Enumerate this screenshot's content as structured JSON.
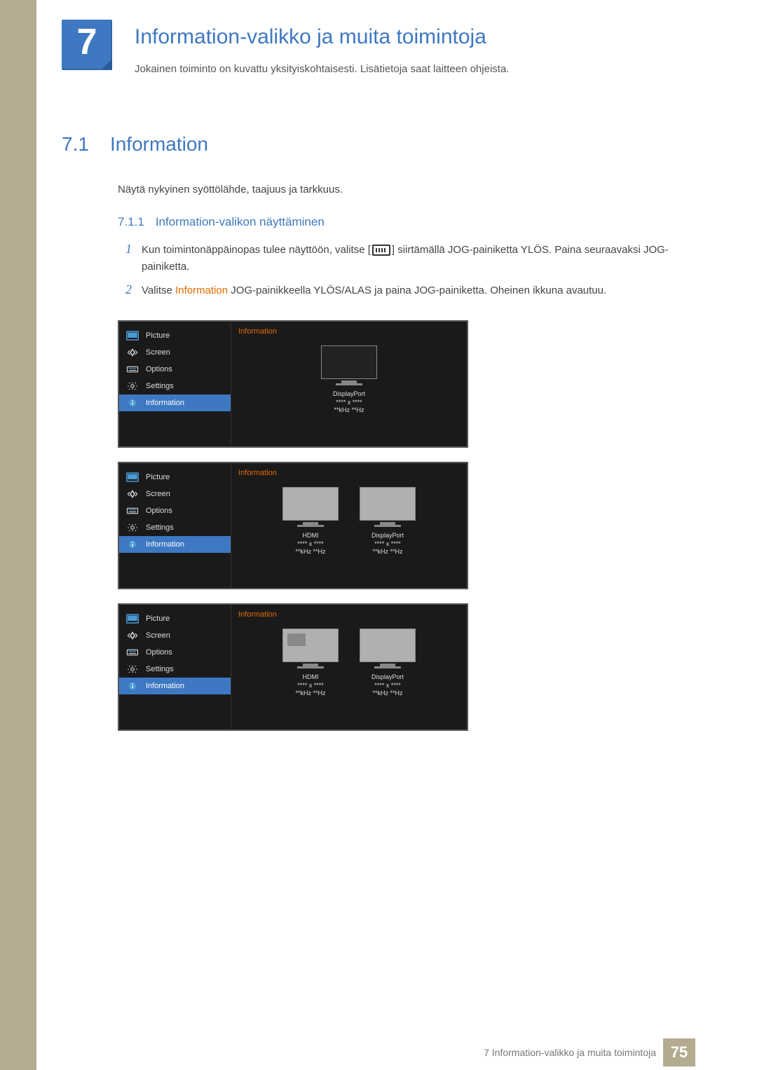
{
  "chapter": {
    "number": "7",
    "title": "Information-valikko ja muita toimintoja",
    "subtitle": "Jokainen toiminto on kuvattu yksityiskohtaisesti. Lisätietoja saat laitteen ohjeista."
  },
  "section": {
    "number": "7.1",
    "title": "Information",
    "desc": "Näytä nykyinen syöttölähde, taajuus ja tarkkuus."
  },
  "subsection": {
    "number": "7.1.1",
    "title": "Information-valikon näyttäminen"
  },
  "steps": {
    "s1_pre": "Kun toimintonäppäinopas tulee näyttöön, valitse [",
    "s1_post": "] siirtämällä JOG-painiketta YLÖS. Paina seuraavaksi JOG-painiketta.",
    "s2_a": "Valitse ",
    "s2_bold": "Information",
    "s2_b": " JOG-painikkeella YLÖS/ALAS ja paina JOG-painiketta. Oheinen ikkuna avautuu."
  },
  "osd": {
    "menu": [
      {
        "label": "Picture",
        "icon": "picture-icon"
      },
      {
        "label": "Screen",
        "icon": "screen-icon"
      },
      {
        "label": "Options",
        "icon": "options-icon"
      },
      {
        "label": "Settings",
        "icon": "settings-icon"
      },
      {
        "label": "Information",
        "icon": "info-icon"
      }
    ],
    "panel_title": "Information",
    "panels": [
      {
        "monitors": [
          {
            "port": "DisplayPort",
            "res": "**** x ****",
            "freq": "**kHz **Hz",
            "style": "dark"
          }
        ]
      },
      {
        "monitors": [
          {
            "port": "HDMI",
            "res": "**** x ****",
            "freq": "**kHz **Hz",
            "style": "light"
          },
          {
            "port": "DisplayPort",
            "res": "**** x ****",
            "freq": "**kHz **Hz",
            "style": "light"
          }
        ]
      },
      {
        "monitors": [
          {
            "port": "HDMI",
            "res": "**** x ****",
            "freq": "**kHz **Hz",
            "style": "pip"
          },
          {
            "port": "DisplayPort",
            "res": "**** x ****",
            "freq": "**kHz **Hz",
            "style": "light"
          }
        ]
      }
    ]
  },
  "footer": {
    "text": "7 Information-valikko ja muita toimintoja",
    "page": "75"
  }
}
